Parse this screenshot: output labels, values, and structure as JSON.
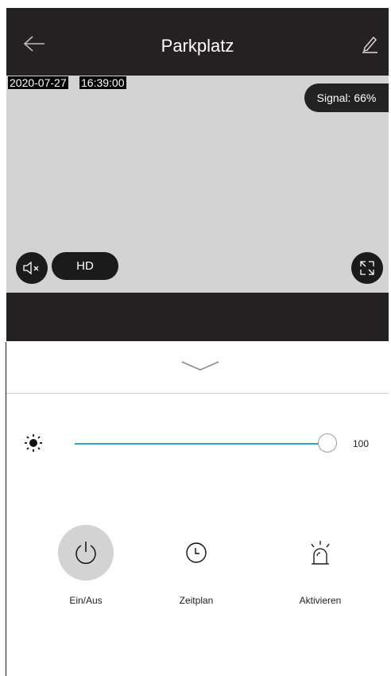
{
  "header": {
    "title": "Parkplatz",
    "back_icon": "arrow-left-icon",
    "edit_icon": "pencil-icon"
  },
  "video": {
    "date": "2020-07-27",
    "time": "16:39:00",
    "signal": "Signal: 66%",
    "mute_icon": "speaker-muted-icon",
    "quality": "HD",
    "fullscreen_icon": "fullscreen-icon"
  },
  "brightness": {
    "icon": "sun-icon",
    "value": 100,
    "value_label": "100",
    "track_color": "#2aa8d8"
  },
  "actions": [
    {
      "label": "Ein/Aus",
      "icon": "power-icon",
      "active": true
    },
    {
      "label": "Zeitplan",
      "icon": "clock-icon",
      "active": false
    },
    {
      "label": "Aktivieren",
      "icon": "alarm-light-icon",
      "active": false
    }
  ],
  "colors": {
    "header_bg": "#232122",
    "video_bg": "#d3d3d3",
    "accent": "#2aa8d8"
  }
}
